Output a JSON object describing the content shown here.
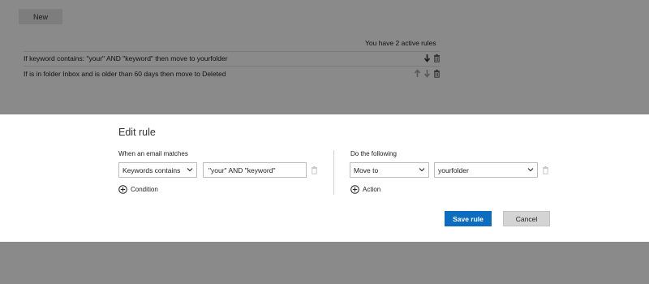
{
  "toolbar": {
    "new_label": "New"
  },
  "rules": {
    "active_count_text": "You have 2 active rules",
    "items": [
      {
        "text": "If keyword contains: \"your\" AND \"keyword\" then move to yourfolder"
      },
      {
        "text": "If is in folder Inbox and is older than 60 days then move to Deleted"
      }
    ]
  },
  "dialog": {
    "title": "Edit rule",
    "condition_section_label": "When an email matches",
    "action_section_label": "Do the following",
    "condition_type": "Keywords contains",
    "condition_value": "\"your\" AND \"keyword\"",
    "add_condition_label": "Condition",
    "action_type": "Move to",
    "action_target": "yourfolder",
    "add_action_label": "Action",
    "save_label": "Save rule",
    "cancel_label": "Cancel"
  },
  "colors": {
    "overlay_gray": "#8a8a8a",
    "primary_blue": "#0b6cc0",
    "cancel_gray": "#d4d4d4"
  },
  "icons": [
    "arrow-down-icon",
    "arrow-up-icon",
    "trash-icon",
    "chevron-down-icon",
    "plus-circle-icon"
  ]
}
